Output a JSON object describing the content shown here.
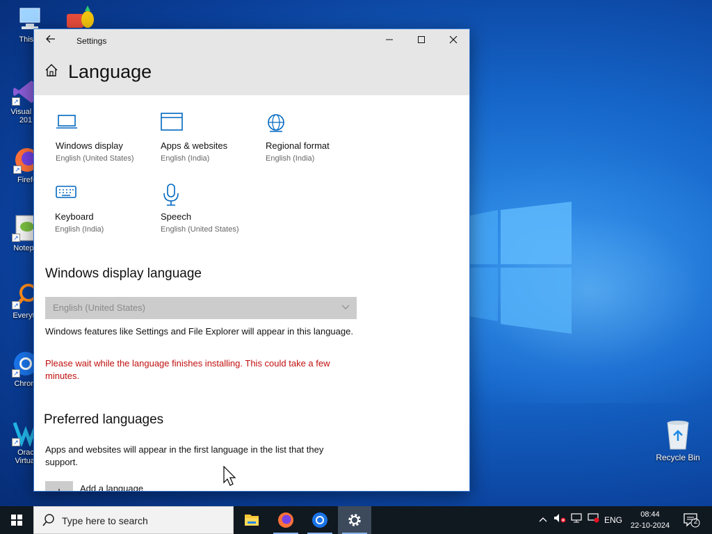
{
  "desktop": {
    "icons": [
      {
        "label": "This P"
      },
      {
        "label": "Visual St"
      },
      {
        "label": "201"
      },
      {
        "label": "Firefo"
      },
      {
        "label": "Notepa"
      },
      {
        "label": "Everyth"
      },
      {
        "label": "Chrom"
      },
      {
        "label": "Orac"
      },
      {
        "label": "Virtual"
      }
    ],
    "recycle_bin_label": "Recycle Bin"
  },
  "window": {
    "title": "Settings",
    "page_title": "Language",
    "tiles": [
      {
        "name": "Windows display",
        "value": "English (United States)",
        "icon": "laptop-icon"
      },
      {
        "name": "Apps & websites",
        "value": "English (India)",
        "icon": "browser-window-icon"
      },
      {
        "name": "Regional format",
        "value": "English (India)",
        "icon": "globe-icon"
      },
      {
        "name": "Keyboard",
        "value": "English (India)",
        "icon": "keyboard-icon"
      },
      {
        "name": "Speech",
        "value": "English (United States)",
        "icon": "microphone-icon"
      }
    ],
    "display_language": {
      "heading": "Windows display language",
      "selected": "English (United States)",
      "description": "Windows features like Settings and File Explorer will appear in this language.",
      "warning": "Please wait while the language finishes installing. This could take a few minutes."
    },
    "preferred": {
      "heading": "Preferred languages",
      "description": "Apps and websites will appear in the first language in the list that they support.",
      "add_label": "Add a language",
      "add_symbol": "+"
    }
  },
  "taskbar": {
    "search_placeholder": "Type here to search",
    "apps": [
      "file-explorer-icon",
      "firefox-icon",
      "chrome-icon",
      "settings-gear-icon"
    ],
    "language": "ENG",
    "time": "08:44",
    "date": "22-10-2024",
    "notification_count": "2"
  },
  "colors": {
    "accent": "#0067c0",
    "warning": "#c10f0f",
    "taskbar": "#101820"
  }
}
